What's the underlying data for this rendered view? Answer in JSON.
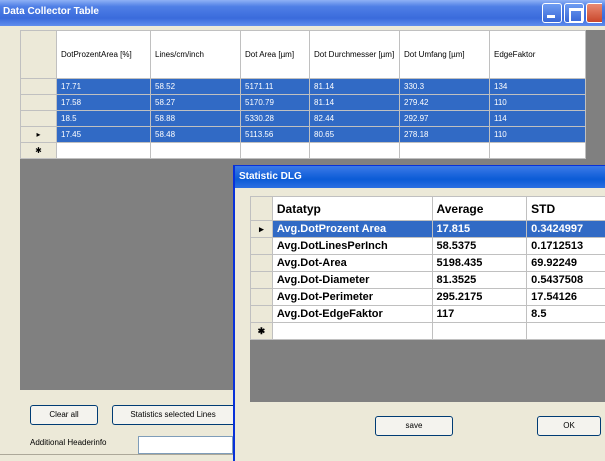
{
  "window": {
    "title": "Data Collector Table"
  },
  "main_table": {
    "columns": [
      "DotProzentArea [%]",
      "Lines/cm/inch",
      "Dot Area [µm]",
      "Dot Durchmesser [µm]",
      "Dot Umfang [µm]",
      "EdgeFaktor"
    ],
    "rows": [
      {
        "marker": "",
        "cells": [
          "17.71",
          "58.52",
          "5171.11",
          "81.14",
          "330.3",
          "134"
        ]
      },
      {
        "marker": "",
        "cells": [
          "17.58",
          "58.27",
          "5170.79",
          "81.14",
          "279.42",
          "110"
        ]
      },
      {
        "marker": "",
        "cells": [
          "18.5",
          "58.88",
          "5330.28",
          "82.44",
          "292.97",
          "114"
        ]
      },
      {
        "marker": "▸",
        "cells": [
          "17.45",
          "58.48",
          "5113.56",
          "80.65",
          "278.18",
          "110"
        ]
      }
    ],
    "new_row_marker": "✱"
  },
  "controls": {
    "clear_all": "Clear all",
    "statistics_selected": "Statistics selected Lines",
    "additional_headers_label": "Additional Headerinfo"
  },
  "dialog": {
    "title": "Statistic DLG",
    "columns": [
      "Datatyp",
      "Average",
      "STD"
    ],
    "rows": [
      {
        "marker": "▸",
        "cells": [
          "Avg.DotProzent Area",
          "17.815",
          "0.3424997"
        ]
      },
      {
        "marker": "",
        "cells": [
          "Avg.DotLinesPerInch",
          "58.5375",
          "0.1712513"
        ]
      },
      {
        "marker": "",
        "cells": [
          "Avg.Dot-Area",
          "5198.435",
          "69.92249"
        ]
      },
      {
        "marker": "",
        "cells": [
          "Avg.Dot-Diameter",
          "81.3525",
          "0.5437508"
        ]
      },
      {
        "marker": "",
        "cells": [
          "Avg.Dot-Perimeter",
          "295.2175",
          "17.54126"
        ]
      },
      {
        "marker": "",
        "cells": [
          "Avg.Dot-EdgeFaktor",
          "117",
          "8.5"
        ]
      }
    ],
    "new_row_marker": "✱",
    "save_label": "save",
    "ok_label": "OK"
  }
}
